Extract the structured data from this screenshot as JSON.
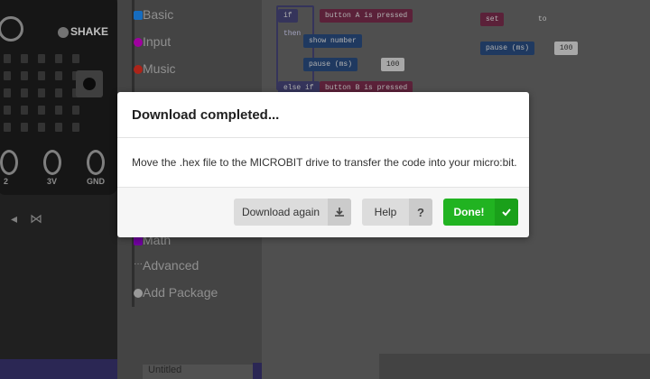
{
  "simulator": {
    "shake_label": "SHAKE",
    "pin_labels": [
      "2",
      "3V",
      "GND"
    ]
  },
  "toolbox": {
    "categories": [
      {
        "label": "Basic",
        "icon": "grid-icon",
        "color": "#1e90ff"
      },
      {
        "label": "Input",
        "icon": "target-icon",
        "color": "#d400d4"
      },
      {
        "label": "Music",
        "icon": "headphones-icon",
        "color": "#e63022"
      },
      {
        "label": "Math",
        "icon": "calculator-icon",
        "color": "#9400d3"
      },
      {
        "label": "Advanced",
        "icon": "ellipsis-icon",
        "color": "#cccccc"
      },
      {
        "label": "Add Package",
        "icon": "plus-circle-icon",
        "color": "#cccccc"
      }
    ],
    "search_placeholder": "Untitled"
  },
  "workspace": {
    "blocks": [
      "if",
      "button A is pressed",
      "then",
      "show number",
      "pause (ms)",
      "100",
      "else if",
      "button B is pressed",
      "set",
      "to",
      "pause (ms)",
      "100"
    ]
  },
  "dialog": {
    "title": "Download completed...",
    "message": "Move the .hex file to the MICROBIT drive to transfer the code into your micro:bit.",
    "buttons": {
      "download_again": "Download again",
      "help": "Help",
      "done": "Done!"
    },
    "icons": {
      "download": "download-icon",
      "help": "question-icon",
      "done": "checkmark-icon"
    },
    "colors": {
      "done": "#21b321",
      "secondary": "#dcdcdc"
    }
  }
}
